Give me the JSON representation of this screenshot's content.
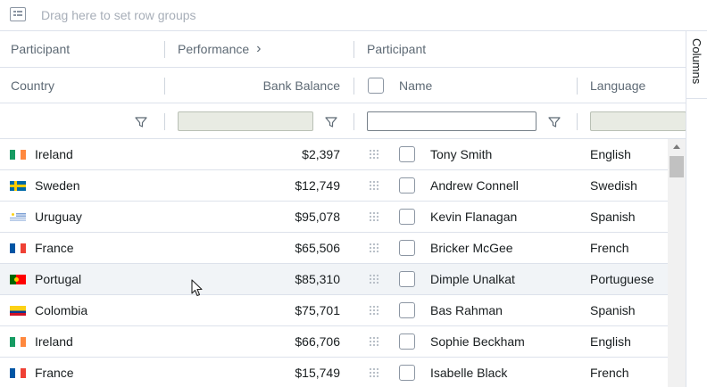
{
  "group_panel": {
    "placeholder": "Drag here to set row groups"
  },
  "header_groups": [
    {
      "label": "Participant"
    },
    {
      "label": "Performance",
      "chevron": "›"
    },
    {
      "label": "Participant"
    }
  ],
  "columns": {
    "country": "Country",
    "bank_balance": "Bank Balance",
    "name": "Name",
    "language": "Language"
  },
  "side_panel": {
    "tab_label": "Columns"
  },
  "rows": [
    {
      "country": "Ireland",
      "flag": "ireland",
      "balance": "$2,397",
      "name": "Tony Smith",
      "language": "English"
    },
    {
      "country": "Sweden",
      "flag": "sweden",
      "balance": "$12,749",
      "name": "Andrew Connell",
      "language": "Swedish"
    },
    {
      "country": "Uruguay",
      "flag": "uruguay",
      "balance": "$95,078",
      "name": "Kevin Flanagan",
      "language": "Spanish"
    },
    {
      "country": "France",
      "flag": "france",
      "balance": "$65,506",
      "name": "Bricker McGee",
      "language": "French"
    },
    {
      "country": "Portugal",
      "flag": "portugal",
      "balance": "$85,310",
      "name": "Dimple Unalkat",
      "language": "Portuguese"
    },
    {
      "country": "Colombia",
      "flag": "colombia",
      "balance": "$75,701",
      "name": "Bas Rahman",
      "language": "Spanish"
    },
    {
      "country": "Ireland",
      "flag": "ireland",
      "balance": "$66,706",
      "name": "Sophie Beckham",
      "language": "English"
    },
    {
      "country": "France",
      "flag": "france",
      "balance": "$15,749",
      "name": "Isabelle Black",
      "language": "French"
    }
  ],
  "hovered_row_index": 4,
  "colors": {
    "border": "#dde2eb",
    "header_text": "#5e6a75",
    "hover_row": "#f1f4f7"
  }
}
